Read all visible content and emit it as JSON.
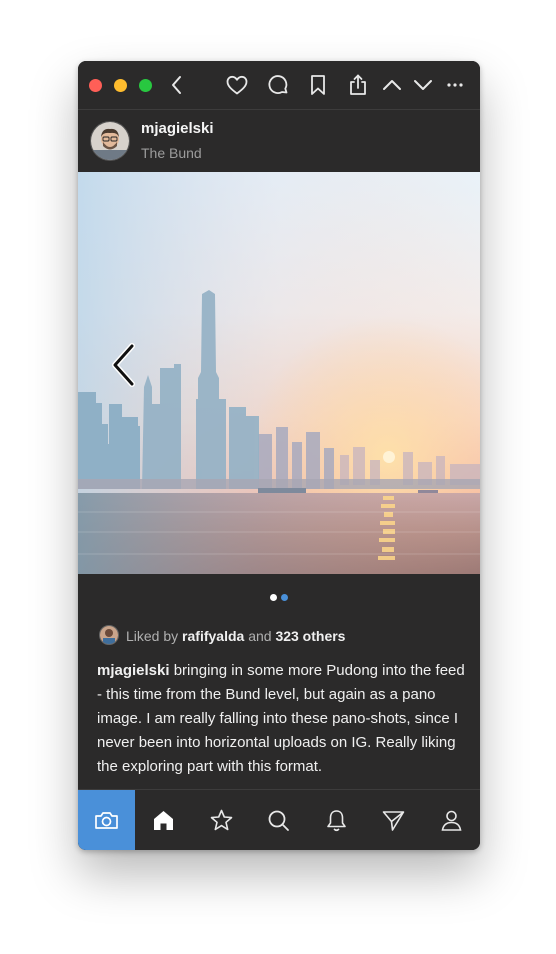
{
  "post": {
    "username": "mjagielski",
    "location": "The Bund",
    "likes": {
      "prefix": "Liked by",
      "user": "rafifyalda",
      "conjunction": "and",
      "others": "323 others"
    },
    "caption": {
      "author": "mjagielski",
      "text": " bringing in some more Pudong into the feed - this time from the Bund level, but again as a pano image. I am really falling into these pano-shots, since I never been into horizontal uploads on IG. Really liking the exploring part with this format."
    },
    "carousel": {
      "total": 2,
      "current": 2
    }
  },
  "titlebar": {
    "icons": [
      "back-icon",
      "heart-icon",
      "comment-icon",
      "bookmark-icon",
      "share-icon",
      "chevron-up-icon",
      "chevron-down-icon",
      "more-icon"
    ]
  },
  "tabbar": {
    "tabs": [
      "camera",
      "home",
      "star",
      "search",
      "bell",
      "send",
      "profile"
    ],
    "active": "camera"
  },
  "colors": {
    "background": "#2b2a2a",
    "accent": "#4a90d9",
    "traffic_red": "#ff5f57",
    "traffic_yellow": "#febc2e",
    "traffic_green": "#28c840"
  }
}
